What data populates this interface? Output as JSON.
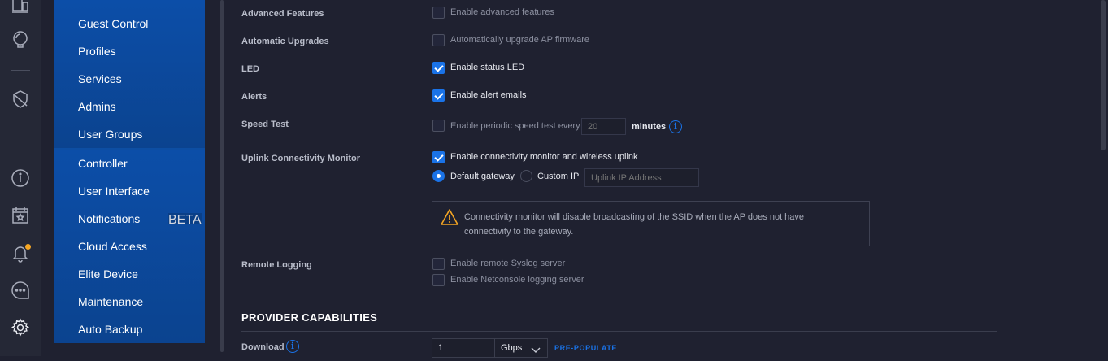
{
  "colors": {
    "accent": "#1a73e8",
    "nav_bg": "#0c4ea8",
    "warning": "#f5a623",
    "page_bg": "#1f2130"
  },
  "rail": {
    "icons": [
      "devices-icon",
      "insights-icon",
      "shield-icon",
      "info-icon",
      "calendar-star-icon",
      "bell-icon",
      "chat-icon",
      "gear-icon"
    ]
  },
  "nav": {
    "group1": [
      "Guest Control",
      "Profiles",
      "Services",
      "Admins",
      "User Groups"
    ],
    "group2": [
      "Controller",
      "User Interface",
      "Notifications",
      "Cloud Access",
      "Elite Device",
      "Maintenance",
      "Auto Backup"
    ],
    "beta_badge": "BETA"
  },
  "settings": {
    "advanced": {
      "label": "Advanced Features",
      "option": "Enable advanced features",
      "checked": false
    },
    "upgrades": {
      "label": "Automatic Upgrades",
      "option": "Automatically upgrade AP firmware",
      "checked": false
    },
    "led": {
      "label": "LED",
      "option": "Enable status LED",
      "checked": true
    },
    "alerts": {
      "label": "Alerts",
      "option": "Enable alert emails",
      "checked": true
    },
    "speedtest": {
      "label": "Speed Test",
      "option": "Enable periodic speed test every",
      "checked": false,
      "interval_placeholder": "20",
      "unit": "minutes"
    },
    "uplink": {
      "label": "Uplink Connectivity Monitor",
      "option": "Enable connectivity monitor and wireless uplink",
      "checked": true,
      "radio_default": "Default gateway",
      "radio_custom": "Custom IP",
      "selected": "Default gateway",
      "ip_placeholder": "Uplink IP Address",
      "warning": "Connectivity monitor will disable broadcasting of the SSID when the AP does not have connectivity to the gateway."
    },
    "logging": {
      "label": "Remote Logging",
      "option_syslog": "Enable remote Syslog server",
      "option_netconsole": "Enable Netconsole logging server",
      "syslog_checked": false,
      "netconsole_checked": false
    }
  },
  "provider": {
    "title": "PROVIDER CAPABILITIES",
    "download_label": "Download",
    "download_value": "1",
    "download_unit": "Gbps",
    "prepopulate": "PRE-POPULATE"
  }
}
